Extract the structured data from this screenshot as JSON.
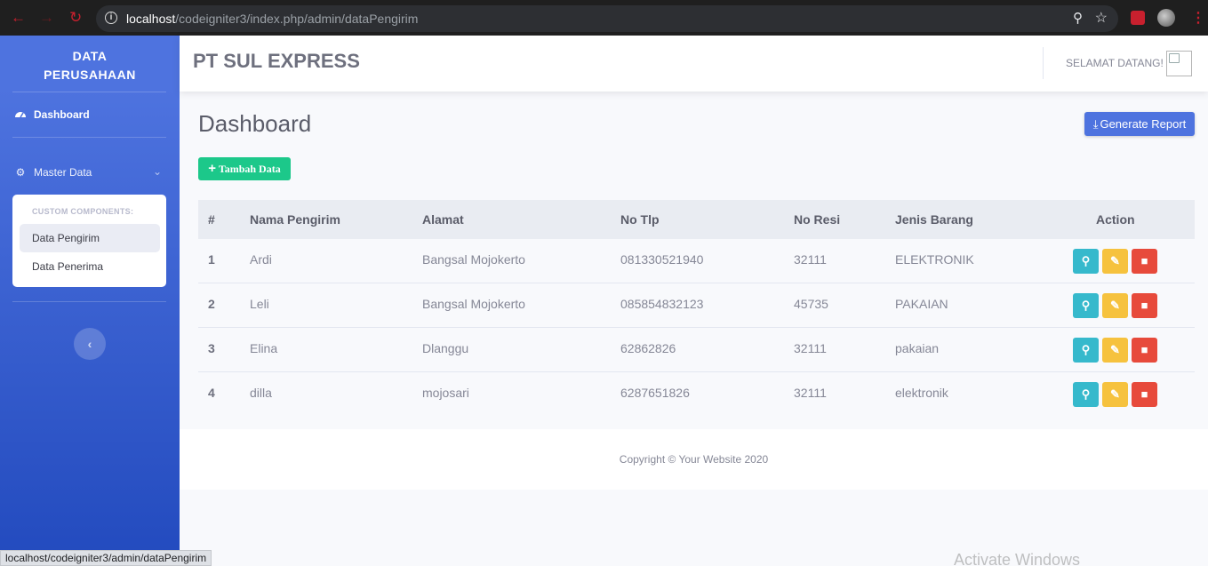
{
  "browser": {
    "url_host": "localhost",
    "url_path": "/codeigniter3/index.php/admin/dataPengirim",
    "status_url": "localhost/codeigniter3/admin/dataPengirim"
  },
  "sidebar": {
    "brand_line1": "DATA",
    "brand_line2": "PERUSAHAAN",
    "dashboard_label": "Dashboard",
    "master_label": "Master Data",
    "collapse_header": "CUSTOM COMPONENTS:",
    "items": [
      {
        "label": "Data Pengirim",
        "active": true
      },
      {
        "label": "Data Penerima",
        "active": false
      }
    ]
  },
  "topbar": {
    "company": "PT SUL EXPRESS",
    "welcome": "SELAMAT DATANG!"
  },
  "main": {
    "title": "Dashboard",
    "report_button": "Generate Report",
    "add_button": "Tambah Data",
    "columns": [
      "#",
      "Nama Pengirim",
      "Alamat",
      "No Tlp",
      "No Resi",
      "Jenis Barang",
      "Action"
    ],
    "rows": [
      {
        "no": "1",
        "nama": "Ardi",
        "alamat": "Bangsal Mojokerto",
        "tlp": "081330521940",
        "resi": "32111",
        "jenis": "ELEKTRONIK"
      },
      {
        "no": "2",
        "nama": "Leli",
        "alamat": "Bangsal Mojokerto",
        "tlp": "085854832123",
        "resi": "45735",
        "jenis": "PAKAIAN"
      },
      {
        "no": "3",
        "nama": "Elina",
        "alamat": "Dlanggu",
        "tlp": "62862826",
        "resi": "32111",
        "jenis": "pakaian"
      },
      {
        "no": "4",
        "nama": "dilla",
        "alamat": "mojosari",
        "tlp": "6287651826",
        "resi": "32111",
        "jenis": "elektronik"
      }
    ]
  },
  "footer": {
    "copyright": "Copyright © Your Website 2020"
  },
  "watermark": "Activate Windows",
  "colors": {
    "primary": "#4e73df",
    "success": "#1cc88a",
    "info": "#36b9cc",
    "warning": "#f6c23e",
    "danger": "#e74a3b"
  }
}
